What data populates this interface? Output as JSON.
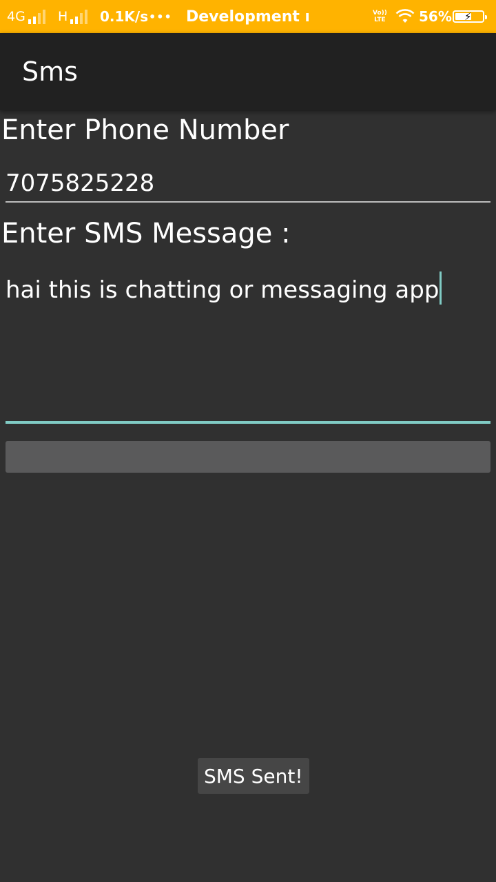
{
  "status_bar": {
    "network_1": "4G",
    "network_2": "H",
    "speed": "0.1K/s",
    "dots": "•••",
    "notification": "Development m",
    "volte_top": "Vo))",
    "volte_bottom": "LTE",
    "wifi_icon": "wifi-icon",
    "battery_percent": "56%",
    "accent_color": "#FFB300"
  },
  "app_bar": {
    "title": "Sms"
  },
  "form": {
    "phone_label": "Enter Phone Number",
    "phone_value": "7075825228",
    "message_label": "Enter SMS Message :",
    "message_value": "hai this is chatting or messaging app",
    "focus_color": "#80CBC4"
  },
  "send_button": {
    "label": ""
  },
  "toast": {
    "text": "SMS Sent!"
  }
}
